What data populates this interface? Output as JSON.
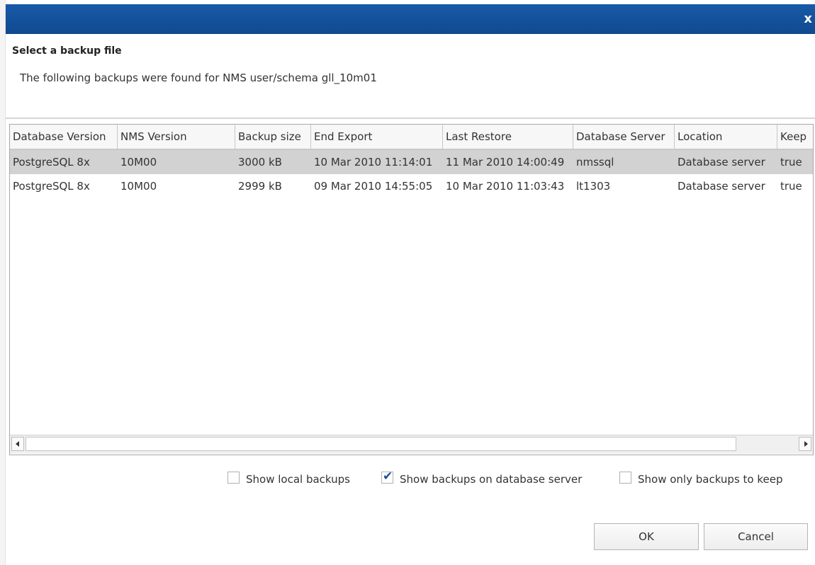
{
  "dialog": {
    "heading": "Select a backup file",
    "subtitle": "The following backups were found for NMS user/schema gll_10m01",
    "close_glyph": "x",
    "accent_color": "#1559a6"
  },
  "table": {
    "columns": [
      "Database Version",
      "NMS Version",
      "Backup size",
      "End Export",
      "Last Restore",
      "Database Server",
      "Location",
      "Keep"
    ],
    "rows": [
      [
        "PostgreSQL 8x",
        "10M00",
        "3000 kB",
        "10 Mar 2010 11:14:01",
        "11 Mar 2010 14:00:49",
        "nmssql",
        "Database server",
        "true"
      ],
      [
        "PostgreSQL 8x",
        "10M00",
        "2999 kB",
        "09 Mar 2010 14:55:05",
        "10 Mar 2010 11:03:43",
        "lt1303",
        "Database server",
        "true"
      ]
    ],
    "selected_row": 0
  },
  "options": {
    "show_local": {
      "label": "Show local backups",
      "checked": false
    },
    "show_db_server": {
      "label": "Show backups on database server",
      "checked": true
    },
    "show_keep_only": {
      "label": "Show only backups to keep",
      "checked": false
    }
  },
  "buttons": {
    "ok": "OK",
    "cancel": "Cancel"
  }
}
